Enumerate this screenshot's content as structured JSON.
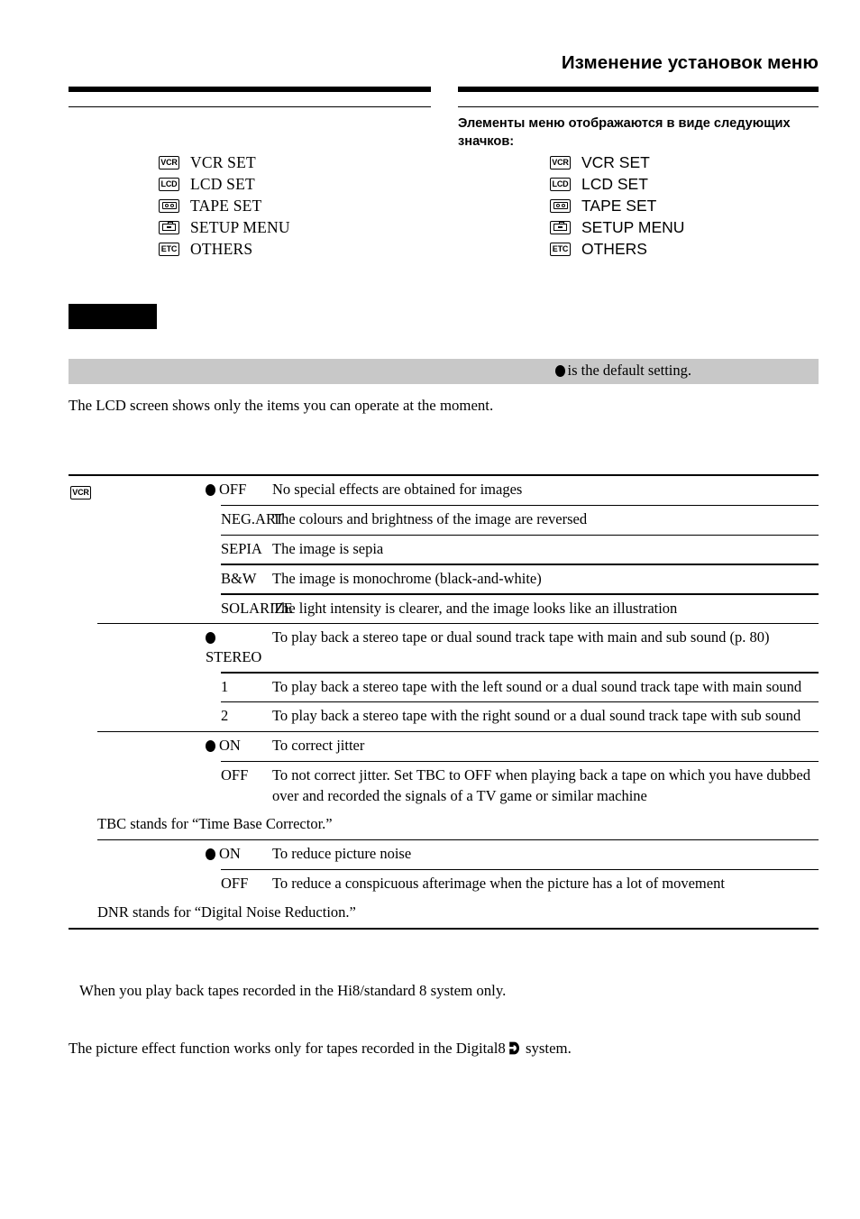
{
  "header": {
    "title": "Изменение установок меню",
    "subhead": "Элементы меню отображаются в виде следующих значков:"
  },
  "legend": {
    "items": [
      {
        "icon": "vcr-icon",
        "icon_text": "VCR",
        "label": "VCR SET"
      },
      {
        "icon": "lcd-icon",
        "icon_text": "LCD",
        "label": "LCD SET"
      },
      {
        "icon": "tape-icon",
        "icon_text": "",
        "label": "TAPE SET"
      },
      {
        "icon": "case-icon",
        "icon_text": "",
        "label": "SETUP MENU"
      },
      {
        "icon": "etc-icon",
        "icon_text": "ETC",
        "label": "OTHERS"
      }
    ]
  },
  "default_bar": {
    "text": "is the default setting.",
    "bg_color": "#c8c8c8"
  },
  "lcd_note": "The LCD screen shows only the items you can operate at the moment.",
  "table": {
    "badge": {
      "icon": "vcr-icon",
      "icon_text": "VCR"
    },
    "groups": [
      {
        "rows": [
          {
            "default": true,
            "option": "OFF",
            "desc": "No special effects are obtained for images"
          },
          {
            "default": false,
            "option": "NEG.ART",
            "desc": "The colours and brightness of the image are reversed"
          },
          {
            "default": false,
            "option": "SEPIA",
            "desc": "The image is sepia"
          },
          {
            "default": false,
            "option": "B&W",
            "desc": "The image is monochrome (black-and-white)"
          },
          {
            "default": false,
            "option": "SOLARIZE",
            "desc": "The light intensity is clearer, and the image looks like an illustration"
          }
        ],
        "note": ""
      },
      {
        "rows": [
          {
            "default": true,
            "option": "STEREO",
            "desc": "To play back a stereo tape or dual sound track tape with main and sub sound (p. 80)"
          },
          {
            "default": false,
            "option": "1",
            "desc": "To play back a stereo tape with the left sound or a dual sound track tape with main sound"
          },
          {
            "default": false,
            "option": "2",
            "desc": "To play back a stereo tape with the right sound or a dual sound track tape with sub sound"
          }
        ],
        "note": ""
      },
      {
        "rows": [
          {
            "default": true,
            "option": "ON",
            "desc": "To correct jitter"
          },
          {
            "default": false,
            "option": "OFF",
            "desc": "To not correct jitter. Set TBC to OFF when playing back a tape on which you have dubbed over and recorded the signals of a TV game or similar machine"
          }
        ],
        "note": "TBC stands for “Time Base Corrector.”"
      },
      {
        "rows": [
          {
            "default": true,
            "option": "ON",
            "desc": "To reduce picture noise"
          },
          {
            "default": false,
            "option": "OFF",
            "desc": "To reduce a conspicuous afterimage when the picture has a lot of movement"
          }
        ],
        "note": "DNR stands for “Digital Noise Reduction.”"
      }
    ]
  },
  "footnotes": {
    "one": "When you play back tapes recorded in the Hi8/standard 8 system only.",
    "two_before": "The picture effect function works only for tapes recorded in the Digital8",
    "two_after": "system.",
    "digital8_icon": "digital8-logo-icon"
  }
}
